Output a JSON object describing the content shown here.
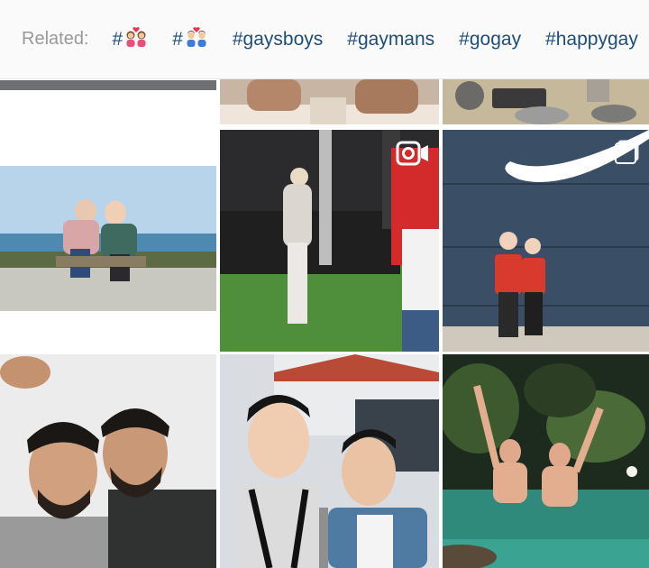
{
  "related": {
    "label": "Related:",
    "tags": [
      {
        "text": "#",
        "emoji": "couple-women-heart"
      },
      {
        "text": "#",
        "emoji": "couple-men-heart"
      },
      {
        "text": "#gaysboys"
      },
      {
        "text": "#gaymans"
      },
      {
        "text": "#gogay"
      },
      {
        "text": "#happygay"
      }
    ]
  },
  "posts": [
    {
      "id": "row0-col0",
      "badge": "none"
    },
    {
      "id": "row0-col1",
      "badge": "none"
    },
    {
      "id": "row0-col2",
      "badge": "none"
    },
    {
      "id": "row1-col0",
      "badge": "carousel-icon"
    },
    {
      "id": "row1-col1",
      "badge": "video-icon"
    },
    {
      "id": "row1-col2",
      "badge": "carousel-icon"
    },
    {
      "id": "row2-col0",
      "badge": "none"
    },
    {
      "id": "row2-col1",
      "badge": "none"
    },
    {
      "id": "row2-col2",
      "badge": "none"
    }
  ],
  "colors": {
    "tag": "#1d4e7a",
    "label": "#999999",
    "bar_bg": "#fafafa"
  }
}
